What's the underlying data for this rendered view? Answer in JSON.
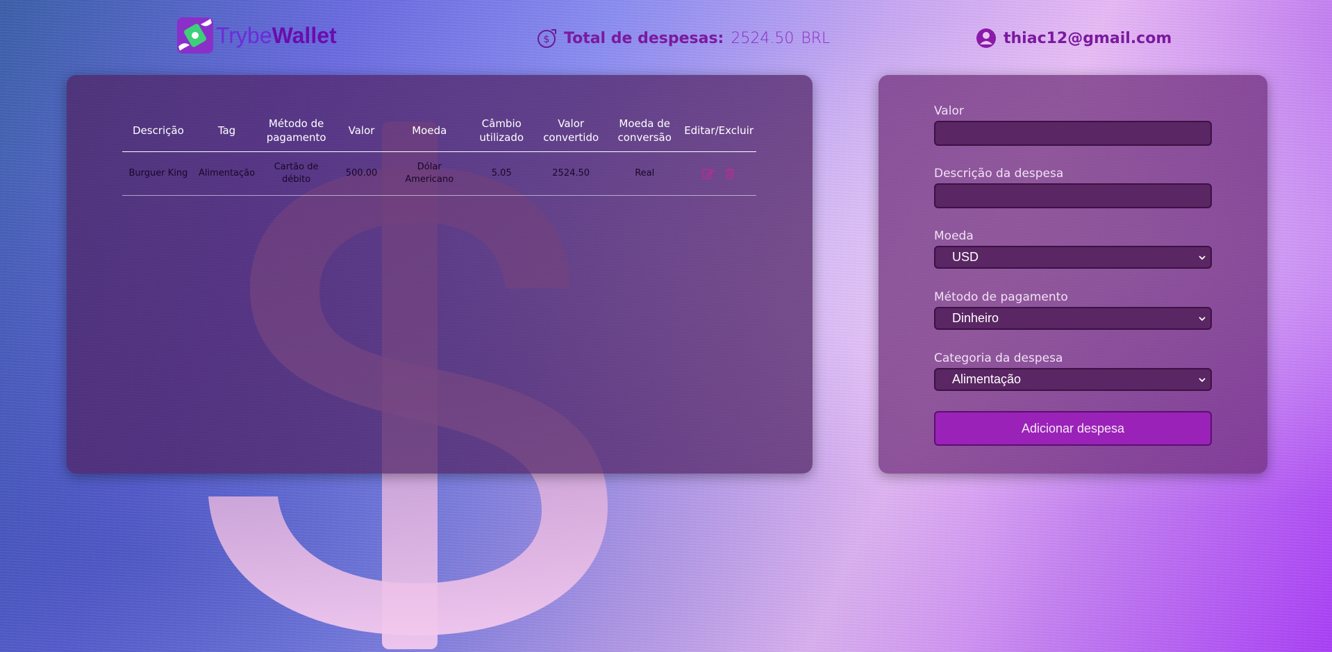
{
  "header": {
    "logo_text_light": "Trybe",
    "logo_text_bold": "Wallet",
    "total_label": "Total de despesas:",
    "total_value": "2524.50",
    "total_currency": "BRL",
    "user_email": "thiac12@gmail.com"
  },
  "table": {
    "columns": [
      "Descrição",
      "Tag",
      "Método de pagamento",
      "Valor",
      "Moeda",
      "Câmbio utilizado",
      "Valor convertido",
      "Moeda de conversão",
      "Editar/Excluir"
    ],
    "rows": [
      {
        "description": "Burguer King",
        "tag": "Alimentação",
        "method": "Cartão de débito",
        "value": "500.00",
        "currency": "Dólar Americano",
        "exchange": "5.05",
        "converted": "2524.50",
        "conversion_currency": "Real"
      }
    ]
  },
  "form": {
    "value_label": "Valor",
    "value_input": "",
    "description_label": "Descrição da despesa",
    "description_input": "",
    "currency_label": "Moeda",
    "currency_selected": "USD",
    "method_label": "Método de pagamento",
    "method_selected": "Dinheiro",
    "category_label": "Categoria da despesa",
    "category_selected": "Alimentação",
    "submit_label": "Adicionar despesa"
  },
  "colors": {
    "accent": "#9b22b8",
    "header_text": "#7a1a9e",
    "panel": "#502364"
  },
  "icons": {
    "total": "dollar-circle-icon",
    "user": "user-circle-icon",
    "edit": "edit-icon",
    "delete": "trash-icon",
    "logo": "wallet-logo-icon"
  }
}
